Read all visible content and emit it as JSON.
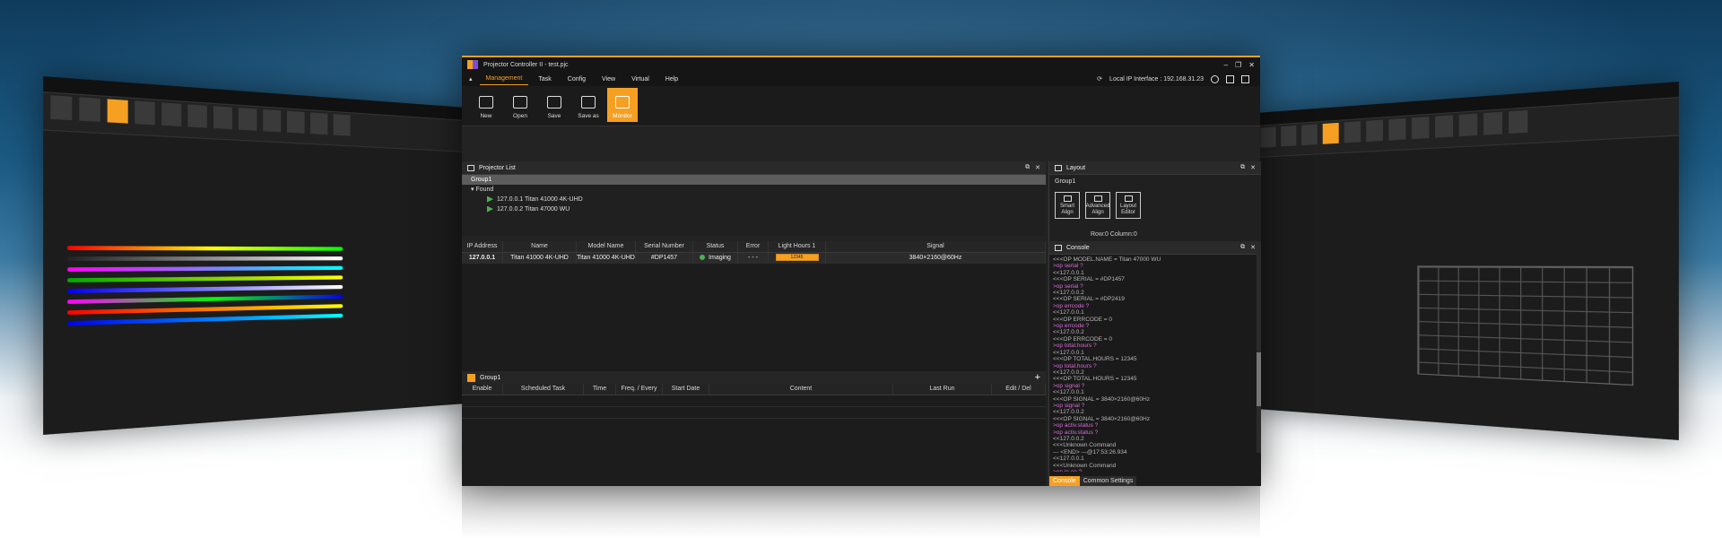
{
  "window": {
    "title": "Projector Controller II - test.pjc"
  },
  "menu": {
    "items": [
      "Management",
      "Task",
      "Config",
      "View",
      "Virtual",
      "Help"
    ],
    "ip_label": "Local IP Interface : 192.168.31.23"
  },
  "ribbon": {
    "buttons": [
      {
        "label": "New",
        "icon": "new-file-icon"
      },
      {
        "label": "Open",
        "icon": "folder-open-icon"
      },
      {
        "label": "Save",
        "icon": "save-icon"
      },
      {
        "label": "Save as",
        "icon": "save-as-icon"
      },
      {
        "label": "Monitor",
        "icon": "monitor-icon",
        "active": true
      }
    ]
  },
  "projector_list": {
    "title": "Projector List",
    "group": "Group1",
    "found_label": "Found",
    "items": [
      "127.0.0.1   Titan 41000 4K-UHD",
      "127.0.0.2   Titan 47000 WU"
    ]
  },
  "layout_panel": {
    "title": "Layout",
    "group": "Group1",
    "buttons": [
      "Smart Align",
      "Advanced Align",
      "Layout Editor"
    ],
    "row_col": "Row:0    Column:0"
  },
  "table": {
    "headers": [
      "IP Address",
      "Name",
      "Model Name",
      "Serial Number",
      "Status",
      "Error",
      "Light Hours 1",
      "Signal"
    ],
    "row": {
      "ip": "127.0.0.1",
      "name": "Titan 41000 4K-UHD",
      "model": "Titan 41000 4K-UHD",
      "serial": "#DP1457",
      "status": "Imaging",
      "error": "- - -",
      "light_hours": "12345",
      "signal": "3840×2160@60Hz"
    }
  },
  "task_panel": {
    "group": "Group1",
    "columns": [
      "Enable",
      "Scheduled Task",
      "Time",
      "Freq. / Every",
      "Start Date",
      "Content",
      "Last Run",
      "Edit / Del"
    ]
  },
  "console": {
    "title": "Console",
    "lines": [
      {
        "t": "res",
        "s": "<<<OP MODEL.NAME = Titan 47000 WU"
      },
      {
        "t": "cmd",
        "s": ">op serial ?"
      },
      {
        "t": "res",
        "s": "<<127.0.0.1"
      },
      {
        "t": "res",
        "s": "<<<OP SERIAL = #DP1457"
      },
      {
        "t": "cmd",
        "s": ">op serial ?"
      },
      {
        "t": "res",
        "s": "<<127.0.0.2"
      },
      {
        "t": "res",
        "s": "<<<OP SERIAL = #DP2419"
      },
      {
        "t": "cmd",
        "s": ">op errcode ?"
      },
      {
        "t": "res",
        "s": "<<127.0.0.1"
      },
      {
        "t": "res",
        "s": "<<<OP ERRCODE = 0"
      },
      {
        "t": "cmd",
        "s": ">op errcode ?"
      },
      {
        "t": "res",
        "s": "<<127.0.0.2"
      },
      {
        "t": "res",
        "s": "<<<OP ERRCODE = 0"
      },
      {
        "t": "cmd",
        "s": ">op total.hours ?"
      },
      {
        "t": "res",
        "s": "<<127.0.0.1"
      },
      {
        "t": "res",
        "s": "<<<OP TOTAL.HOURS = 12345"
      },
      {
        "t": "cmd",
        "s": ">op total.hours ?"
      },
      {
        "t": "res",
        "s": "<<127.0.0.2"
      },
      {
        "t": "res",
        "s": "<<<OP TOTAL.HOURS = 12345"
      },
      {
        "t": "cmd",
        "s": ">op signal ?"
      },
      {
        "t": "res",
        "s": "<<127.0.0.1"
      },
      {
        "t": "res",
        "s": "<<<OP SIGNAL = 3840×2160@60Hz"
      },
      {
        "t": "cmd",
        "s": ">op signal ?"
      },
      {
        "t": "res",
        "s": "<<127.0.0.2"
      },
      {
        "t": "res",
        "s": "<<<OP SIGNAL = 3840×2160@60Hz"
      },
      {
        "t": "cmd",
        "s": ">op activ.status ?"
      },
      {
        "t": "cmd",
        "s": ">op activ.status ?"
      },
      {
        "t": "res",
        "s": "<<127.0.0.2"
      },
      {
        "t": "res",
        "s": "<<<Unknown Command"
      },
      {
        "t": "res",
        "s": "--- <END> ---@17:53:26.934"
      },
      {
        "t": "res",
        "s": "<<127.0.0.1"
      },
      {
        "t": "res",
        "s": "<<<Unknown Command"
      },
      {
        "t": "cmd",
        "s": ">op ip.on ?"
      },
      {
        "t": "res",
        "s": "<<127.0.0.1"
      },
      {
        "t": "res",
        "s": "<<<OP IP.ON = 0"
      },
      {
        "t": "res",
        "s": "--- <END> ---@17:53:26.933"
      }
    ],
    "tabs": [
      "Console",
      "Common Settings"
    ]
  },
  "colors": {
    "accent": "#f5a023",
    "ok": "#4caf50",
    "command": "#d86ad8"
  }
}
